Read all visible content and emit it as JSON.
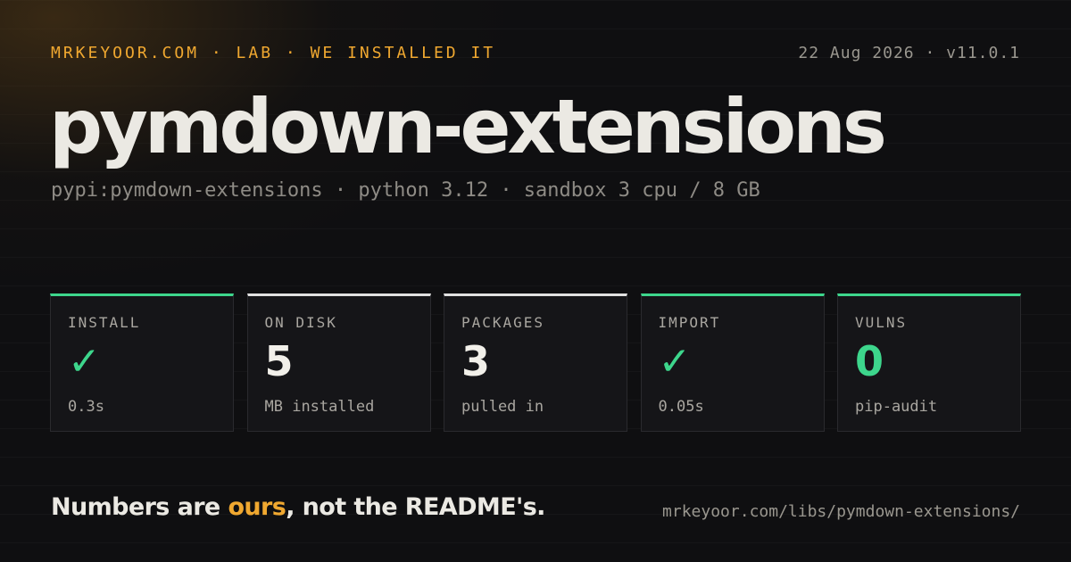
{
  "header": {
    "kicker": "MRKEYOOR.COM · LAB · WE INSTALLED IT",
    "meta": "22 Aug 2026 · v11.0.1"
  },
  "package": {
    "name": "pymdown-extensions",
    "details": "pypi:pymdown-extensions · python 3.12 · sandbox 3 cpu / 8 GB"
  },
  "colors": {
    "accent": "#f0a830",
    "good": "#3dd68c",
    "neutral": "#e0e0e0"
  },
  "stats": [
    {
      "label": "INSTALL",
      "value": "✓",
      "sub": "0.3s",
      "status": "good"
    },
    {
      "label": "ON DISK",
      "value": "5",
      "sub": "MB installed",
      "status": "neutral"
    },
    {
      "label": "PACKAGES",
      "value": "3",
      "sub": "pulled in",
      "status": "neutral"
    },
    {
      "label": "IMPORT",
      "value": "✓",
      "sub": "0.05s",
      "status": "good"
    },
    {
      "label": "VULNS",
      "value": "0",
      "sub": "pip-audit",
      "status": "good"
    }
  ],
  "footer": {
    "tagline_before": "Numbers are ",
    "tagline_accent": "ours",
    "tagline_after": ", not the README's.",
    "url": "mrkeyoor.com/libs/pymdown-extensions/"
  }
}
